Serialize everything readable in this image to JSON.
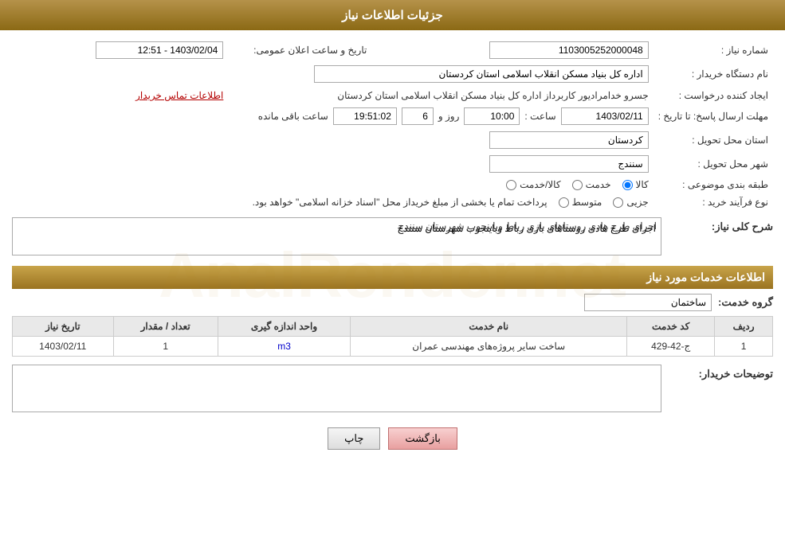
{
  "header": {
    "title": "جزئیات اطلاعات نیاز"
  },
  "fields": {
    "reference_number_label": "شماره نیاز :",
    "reference_number_value": "1103005252000048",
    "buyer_org_label": "نام دستگاه خریدار :",
    "buyer_org_value": "اداره کل بنیاد مسکن انقلاب اسلامی استان کردستان",
    "created_by_label": "ایجاد کننده درخواست :",
    "created_by_value": "جسرو خدامرادیور کاربرداز اداره کل بنیاد مسکن انقلاب اسلامی استان کردستان",
    "contact_link": "اطلاعات تماس خریدار",
    "response_deadline_label": "مهلت ارسال پاسخ: تا تاریخ :",
    "response_date": "1403/02/11",
    "response_time_label": "ساعت :",
    "response_time": "10:00",
    "response_days_label": "روز و",
    "response_days": "6",
    "response_remaining_label": "ساعت باقی مانده",
    "response_remaining": "19:51:02",
    "province_label": "استان محل تحویل :",
    "province_value": "کردستان",
    "city_label": "شهر محل تحویل :",
    "city_value": "سنندج",
    "category_label": "طبقه بندی موضوعی :",
    "category_options": [
      "کالا",
      "خدمت",
      "کالا/خدمت"
    ],
    "category_selected": "کالا",
    "purchase_type_label": "نوع فرآیند خرید :",
    "purchase_type_options": [
      "جزیی",
      "متوسط"
    ],
    "purchase_type_notice": "پرداخت تمام یا بخشی از مبلغ خریداز محل \"اسناد خزانه اسلامی\" خواهد بود.",
    "announcement_datetime_label": "تاریخ و ساعت اعلان عمومی:",
    "announcement_datetime": "1403/02/04 - 12:51",
    "general_desc_label": "شرح کلی نیاز:",
    "general_desc_value": "اجرای طرح هادی روستاهای بازی رباط وباینجوب شهرستان سنندج"
  },
  "services_section": {
    "title": "اطلاعات خدمات مورد نیاز",
    "service_group_label": "گروه خدمت:",
    "service_group_value": "ساختمان",
    "table": {
      "headers": [
        "ردیف",
        "کد خدمت",
        "نام خدمت",
        "واحد اندازه گیری",
        "تعداد / مقدار",
        "تاریخ نیاز"
      ],
      "rows": [
        {
          "row": "1",
          "code": "ج-42-429",
          "name": "ساخت سایر پروژه‌های مهندسی عمران",
          "unit": "m3",
          "quantity": "1",
          "date": "1403/02/11"
        }
      ]
    }
  },
  "buyer_desc_label": "توضیحات خریدار:",
  "buyer_desc_value": "",
  "buttons": {
    "print": "چاپ",
    "back": "بازگشت"
  }
}
